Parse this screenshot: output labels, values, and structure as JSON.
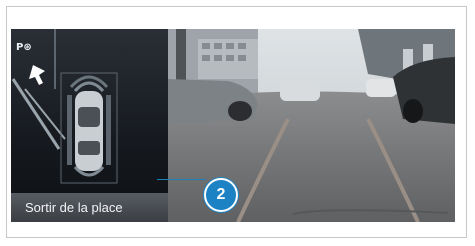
{
  "parking_assist": {
    "mode_icon": "P-wheel-icon",
    "mode_text": "P",
    "exit_button_label": "Sortir de la place",
    "callout_number": "2"
  },
  "colors": {
    "callout": "#1c82c4",
    "button": "#4a4f55",
    "overlay_lines": "#9a8f86"
  }
}
